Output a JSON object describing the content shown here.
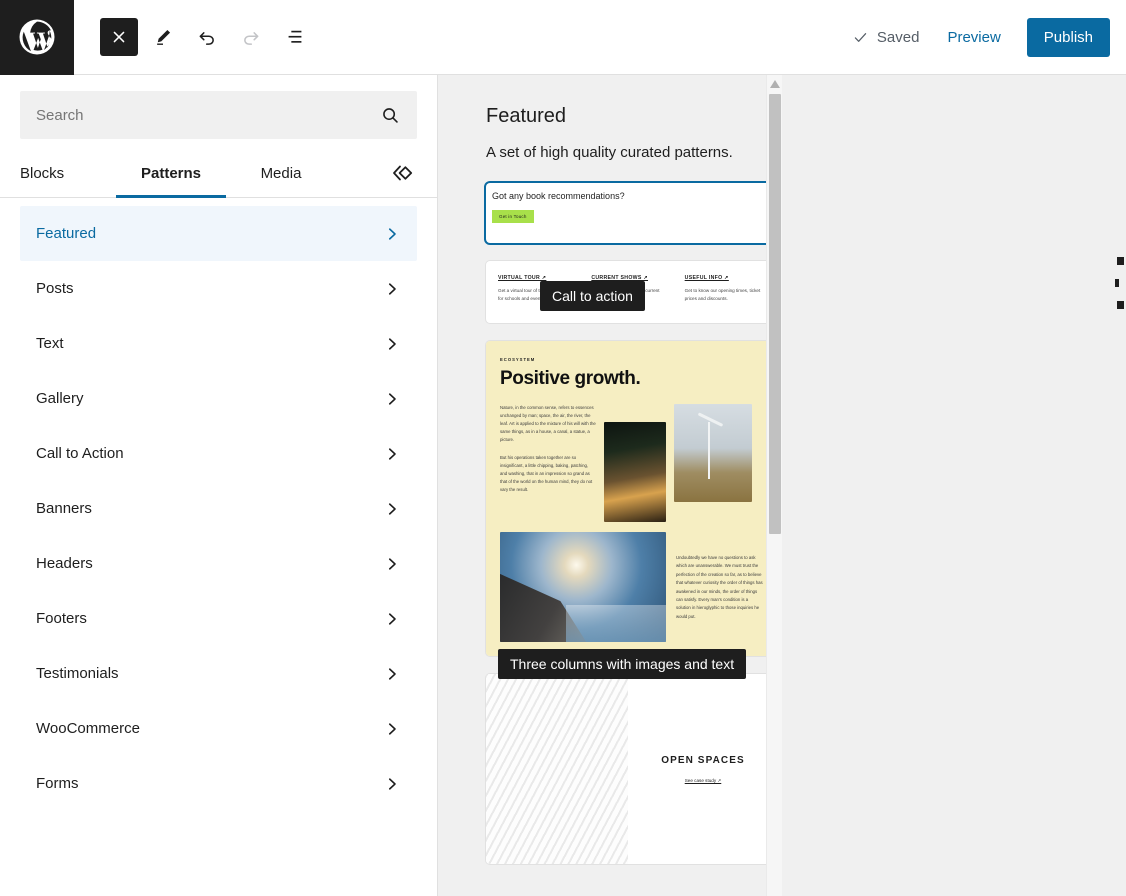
{
  "header": {
    "logo_icon": "wordpress-logo-icon",
    "tools": [
      {
        "name": "close-inserter-button",
        "icon": "close-icon",
        "state": "active"
      },
      {
        "name": "edit-tool-button",
        "icon": "pencil-icon",
        "state": "enabled"
      },
      {
        "name": "undo-button",
        "icon": "undo-arrow-icon",
        "state": "enabled"
      },
      {
        "name": "redo-button",
        "icon": "redo-arrow-icon",
        "state": "disabled"
      },
      {
        "name": "list-view-button",
        "icon": "list-view-icon",
        "state": "enabled"
      }
    ],
    "saved_label": "Saved",
    "saved_icon": "checkmark-icon",
    "preview_label": "Preview",
    "publish_label": "Publish",
    "publish_color": "#0a6aa1"
  },
  "inserter": {
    "search": {
      "placeholder": "Search",
      "value": "",
      "icon": "search-icon"
    },
    "tabs": [
      {
        "label": "Blocks",
        "active": false
      },
      {
        "label": "Patterns",
        "active": true
      },
      {
        "label": "Media",
        "active": false
      }
    ],
    "media_toggle_icon": "double-chevron-left-icon",
    "categories": [
      {
        "label": "Featured",
        "selected": true
      },
      {
        "label": "Posts",
        "selected": false
      },
      {
        "label": "Text",
        "selected": false
      },
      {
        "label": "Gallery",
        "selected": false
      },
      {
        "label": "Call to Action",
        "selected": false
      },
      {
        "label": "Banners",
        "selected": false
      },
      {
        "label": "Headers",
        "selected": false
      },
      {
        "label": "Footers",
        "selected": false
      },
      {
        "label": "Testimonials",
        "selected": false
      },
      {
        "label": "WooCommerce",
        "selected": false
      },
      {
        "label": "Forms",
        "selected": false
      }
    ],
    "selected_accent": "#0a6aa1",
    "selected_bg": "#f0f6fc"
  },
  "preview": {
    "title": "Featured",
    "subtitle": "A set of high quality curated patterns.",
    "tooltips": {
      "call_to_action": "Call to action",
      "three_columns": "Three columns with images and text"
    },
    "patterns": {
      "cta": {
        "heading": "Got any book recommendations?",
        "button_label": "Get in Touch",
        "button_color": "#a8e04a",
        "selected": true
      },
      "three_links": {
        "columns": [
          {
            "heading": "VIRTUAL TOUR ↗",
            "text": "Get a virtual tour of the museum, ideal for schools and events."
          },
          {
            "heading": "CURRENT SHOWS ↗",
            "text": "Stay updated and see our current exhibitions here."
          },
          {
            "heading": "USEFUL INFO ↗",
            "text": "Get to know our opening times, ticket prices and discounts."
          }
        ]
      },
      "positive_growth": {
        "eyebrow": "ECOSYSTEM",
        "title": "Positive growth.",
        "background_color": "#f6eec2",
        "paragraph_1": "Nature, in the common sense, refers to essences unchanged by man; space, the air, the river, the leaf. Art is applied to the mixture of his will with the same things, as in a house, a canal, a statue, a picture.",
        "paragraph_2": "But his operations taken together are so insignificant, a little chipping, baking, patching, and washing, that in an impression so grand as that of the world on the human mind, they do not vary the result.",
        "paragraph_3": "Undoubtedly we have no questions to ask which are unanswerable. We must trust the perfection of the creation so far, as to believe that whatever curiosity the order of things has awakened in our minds, the order of things can satisfy. Every man's condition is a solution in hieroglyphic to those inquiries he would put.",
        "images": [
          "forest-image",
          "wind-turbine-image",
          "coastal-sunset-image"
        ]
      },
      "open_spaces": {
        "title": "OPEN SPACES",
        "link_label": "See case study ↗"
      }
    }
  },
  "scrollbar": {
    "name": "preview-vertical-scrollbar",
    "arrow_icon": "scroll-up-arrow-icon"
  }
}
